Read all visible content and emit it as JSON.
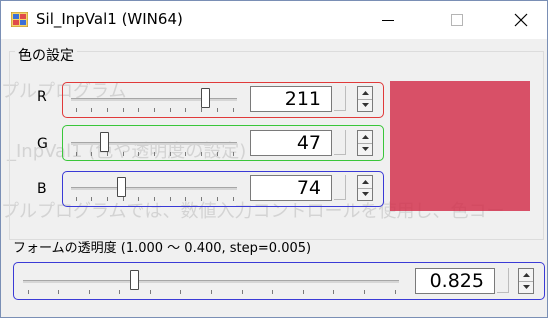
{
  "window": {
    "title": "Sil_InpVal1 (WIN64)",
    "minimize_glyph": "—",
    "maximize_glyph": "☐",
    "close_glyph": "✕"
  },
  "background_text": [
    "プルプログラム",
    "_InpVal1 (色や透明度の設定)",
    "プルプログラムでは、数値入力コントロールを使用し、色コー"
  ],
  "color_group": {
    "title": "色の設定",
    "rows": [
      {
        "label": "R",
        "value": "211",
        "level": 0.827,
        "border_color": "#e03a3a"
      },
      {
        "label": "G",
        "value": "47",
        "level": 0.184,
        "border_color": "#3ac63a"
      },
      {
        "label": "B",
        "value": "74",
        "level": 0.29,
        "border_color": "#3a3ad6"
      }
    ],
    "preview_color": "#d32f4a"
  },
  "opacity": {
    "label": "フォームの透明度 (1.000 〜 0.400, step=0.005)",
    "value": "0.825",
    "level": 0.292,
    "border_color": "#3b3bd6"
  }
}
